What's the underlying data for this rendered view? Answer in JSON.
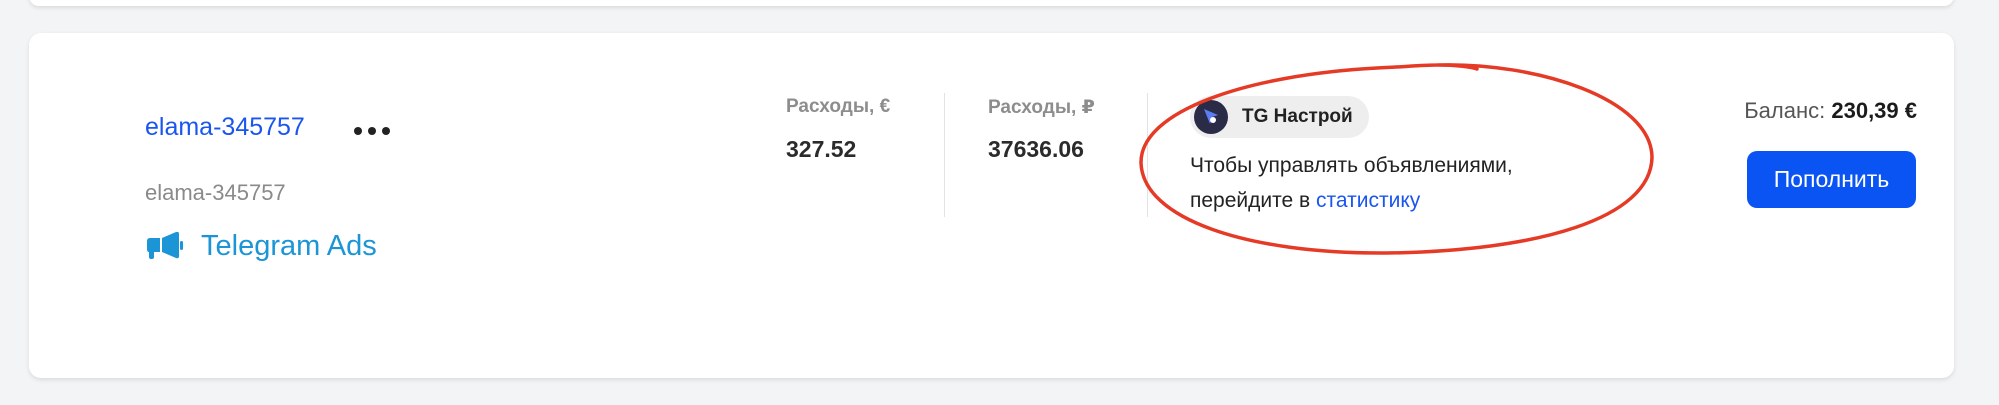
{
  "account": {
    "name": "elama-345757",
    "subtitle": "elama-345757",
    "platform": "Telegram Ads",
    "platform_icon": "megaphone-icon",
    "more_icon": "more-dots-icon"
  },
  "metrics": [
    {
      "label": "Расходы, €",
      "value": "327.52"
    },
    {
      "label": "Расходы, ₽",
      "value": "37636.06"
    }
  ],
  "campaign": {
    "badge": "TG Настрой",
    "badge_icon": "cursor-arrow-icon",
    "hint_text": "Чтобы управлять объявлениями, перейдите в",
    "hint_link": "статистику"
  },
  "balance": {
    "label": "Баланс:",
    "value": "230,39 €"
  },
  "actions": {
    "topup_label": "Пополнить"
  },
  "colors": {
    "link": "#1a55f0",
    "platform": "#1b95d6",
    "primary_button": "#0a54f4",
    "annotation_circle": "#e53a26"
  }
}
